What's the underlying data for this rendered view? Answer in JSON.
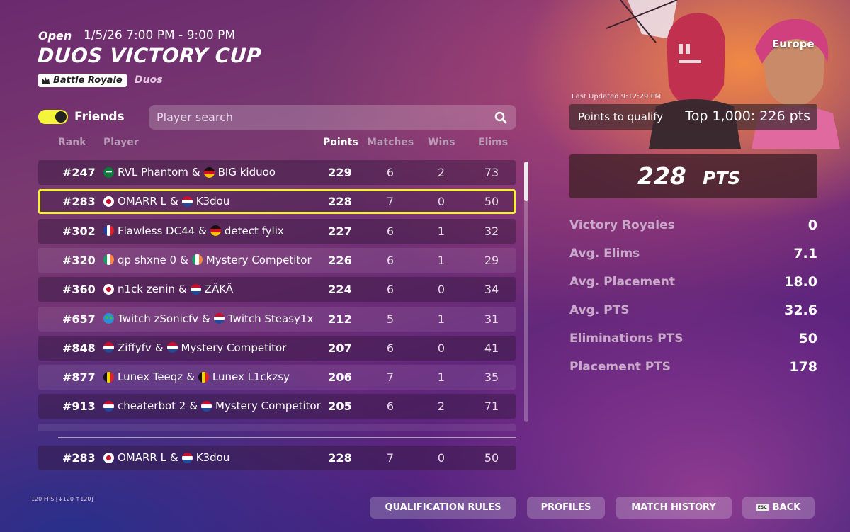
{
  "event": {
    "status": "Open",
    "time": "1/5/26 7:00 PM - 9:00 PM",
    "title": "DUOS VICTORY CUP",
    "mode_label": "Battle Royale",
    "mode_sub": "Duos"
  },
  "friends_toggle": {
    "label": "Friends",
    "on": true
  },
  "search": {
    "placeholder": "Player search"
  },
  "columns": {
    "rank": "Rank",
    "player": "Player",
    "points": "Points",
    "matches": "Matches",
    "wins": "Wins",
    "elims": "Elims"
  },
  "rows": [
    {
      "rank": "#247",
      "p1": "RVL Phantom",
      "f1": "sa",
      "p2": "BIG kiduoo",
      "f2": "de",
      "points": "229",
      "matches": "6",
      "wins": "2",
      "elims": "73"
    },
    {
      "rank": "#283",
      "p1": "OMARR L",
      "f1": "jp",
      "p2": "K3dou",
      "f2": "nl",
      "points": "228",
      "matches": "7",
      "wins": "0",
      "elims": "50",
      "highlight": true
    },
    {
      "rank": "#302",
      "p1": "Flawless DC44",
      "f1": "fr",
      "p2": "detect fylix",
      "f2": "de",
      "points": "227",
      "matches": "6",
      "wins": "1",
      "elims": "32"
    },
    {
      "rank": "#320",
      "p1": "qp shxne 0",
      "f1": "ie",
      "p2": "Mystery Competitor",
      "f2": "ie",
      "points": "226",
      "matches": "6",
      "wins": "1",
      "elims": "29"
    },
    {
      "rank": "#360",
      "p1": "n1ck zenin",
      "f1": "jp",
      "p2": "ZÄKÂ",
      "f2": "nl",
      "points": "224",
      "matches": "6",
      "wins": "0",
      "elims": "34"
    },
    {
      "rank": "#657",
      "p1": "Twitch zSonicfv",
      "f1": "globe",
      "p2": "Twitch Steasy1x",
      "f2": "nl",
      "points": "212",
      "matches": "5",
      "wins": "1",
      "elims": "31"
    },
    {
      "rank": "#848",
      "p1": "Ziffyfv",
      "f1": "nl",
      "p2": "Mystery Competitor",
      "f2": "nl",
      "points": "207",
      "matches": "6",
      "wins": "0",
      "elims": "41"
    },
    {
      "rank": "#877",
      "p1": "Lunex Teeqz",
      "f1": "be",
      "p2": "Lunex L1ckzsy",
      "f2": "be",
      "points": "206",
      "matches": "7",
      "wins": "1",
      "elims": "35"
    },
    {
      "rank": "#913",
      "p1": "cheaterbot 2",
      "f1": "nl",
      "p2": "Mystery Competitor",
      "f2": "nl",
      "points": "205",
      "matches": "6",
      "wins": "2",
      "elims": "71"
    }
  ],
  "my_row": {
    "rank": "#283",
    "p1": "OMARR L",
    "f1": "jp",
    "p2": "K3dou",
    "f2": "nl",
    "points": "228",
    "matches": "7",
    "wins": "0",
    "elims": "50"
  },
  "side": {
    "region": "Europe",
    "last_updated": "Last Updated 9:12:29 PM",
    "qualify_label": "Points to qualify",
    "qualify_value": "Top 1,000: 226 pts",
    "total_points": "228",
    "total_unit": "PTS",
    "stats": [
      {
        "label": "Victory Royales",
        "value": "0"
      },
      {
        "label": "Avg. Elims",
        "value": "7.1"
      },
      {
        "label": "Avg. Placement",
        "value": "18.0"
      },
      {
        "label": "Avg. PTS",
        "value": "32.6"
      },
      {
        "label": "Eliminations PTS",
        "value": "50"
      },
      {
        "label": "Placement PTS",
        "value": "178"
      }
    ]
  },
  "fps": "120 FPS [↓120 ↑120]",
  "buttons": {
    "qualification_rules": "QUALIFICATION RULES",
    "profiles": "PROFILES",
    "match_history": "MATCH HISTORY",
    "back": "BACK",
    "back_key": "ESC"
  },
  "colors": {
    "highlight": "#f6f23a",
    "toggle_on": "#f4f43a"
  }
}
